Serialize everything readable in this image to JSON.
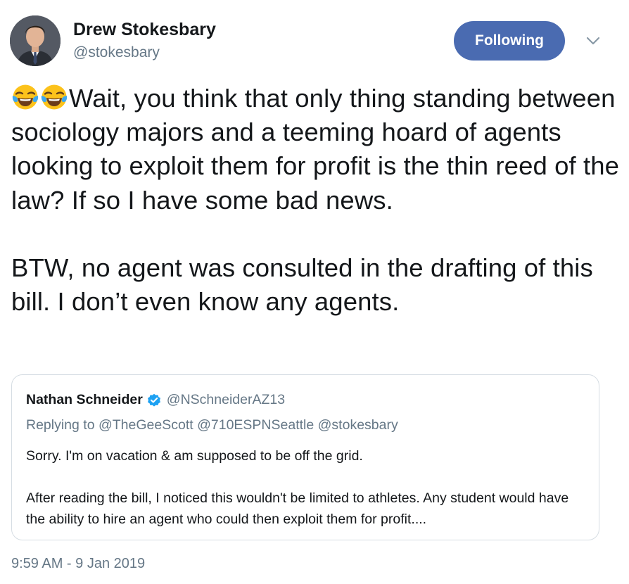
{
  "tweet": {
    "author": {
      "name": "Drew Stokesbary",
      "handle": "@stokesbary"
    },
    "follow_button_label": "Following",
    "text_paragraph_1": "Wait, you think that only thing standing between sociology majors and a teeming hoard of agents looking to exploit them for profit is the thin reed of the law? If so I have some bad news.",
    "text_paragraph_2": "BTW, no agent was consulted in the drafting of this bill. I don’t even know any agents.",
    "emojis": [
      "face-with-tears-of-joy-icon",
      "face-with-tears-of-joy-icon"
    ],
    "timestamp": "9:59 AM - 9 Jan 2019"
  },
  "quoted_tweet": {
    "author_name": "Nathan Schneider",
    "author_handle": "@NSchneiderAZ13",
    "verified": true,
    "replying_to": "Replying to @TheGeeScott @710ESPNSeattle @stokesbary",
    "body_paragraph_1": "Sorry. I'm on vacation & am supposed to be off the grid.",
    "body_paragraph_2": "After reading the bill, I noticed this wouldn't be limited to athletes. Any student would have the ability to hire an agent who could then exploit them for profit...."
  },
  "colors": {
    "follow_button": "#4a6bb1",
    "secondary_text": "#657786",
    "primary_text": "#14171a",
    "verified_badge": "#1da1f2",
    "quote_border": "#d6dde3"
  }
}
